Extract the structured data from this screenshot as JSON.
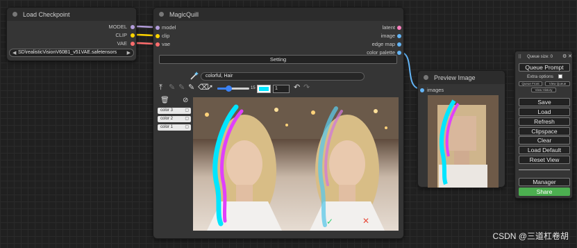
{
  "load_checkpoint": {
    "title": "Load Checkpoint",
    "outputs": [
      "MODEL",
      "CLIP",
      "VAE"
    ],
    "ckpt_name": "SD\\realisticVisionV60B1_v51VAE.safetensors"
  },
  "magicquill": {
    "title": "MagicQuill",
    "inputs": [
      "model",
      "clip",
      "vae"
    ],
    "outputs": [
      "latent",
      "image",
      "edge map",
      "color palette"
    ],
    "setting_label": "Setting",
    "prompt_value": "colorful, Hair",
    "brush_size_value": "15",
    "alpha_value": "1",
    "brush_color": "#00e5ff",
    "layers": [
      {
        "label": "color 3"
      },
      {
        "label": "color 2"
      },
      {
        "label": "color 1"
      }
    ],
    "accept_icon": "check-icon",
    "reject_icon": "x-icon"
  },
  "preview_image": {
    "title": "Preview Image",
    "input": "images"
  },
  "queue_panel": {
    "queue_size": "Queue size: 0",
    "queue_prompt": "Queue Prompt",
    "extra_options": "Extra options",
    "queue_front": "Queue Front",
    "view_queue": "View Queue",
    "view_history": "View History",
    "buttons": [
      "Save",
      "Load",
      "Refresh",
      "Clipspace",
      "Clear",
      "Load Default",
      "Reset View"
    ],
    "manager": "Manager",
    "share": "Share",
    "share_color": "#4caf50"
  },
  "watermark": "CSDN @三道杠卷胡",
  "colors": {
    "model_wire": "#b39ddb",
    "clip_wire": "#ffd500",
    "vae_wire": "#ff6e6e",
    "image_wire": "#64b5f6",
    "stroke_cyan": "#00e5ff",
    "stroke_magenta": "#e040fb"
  }
}
